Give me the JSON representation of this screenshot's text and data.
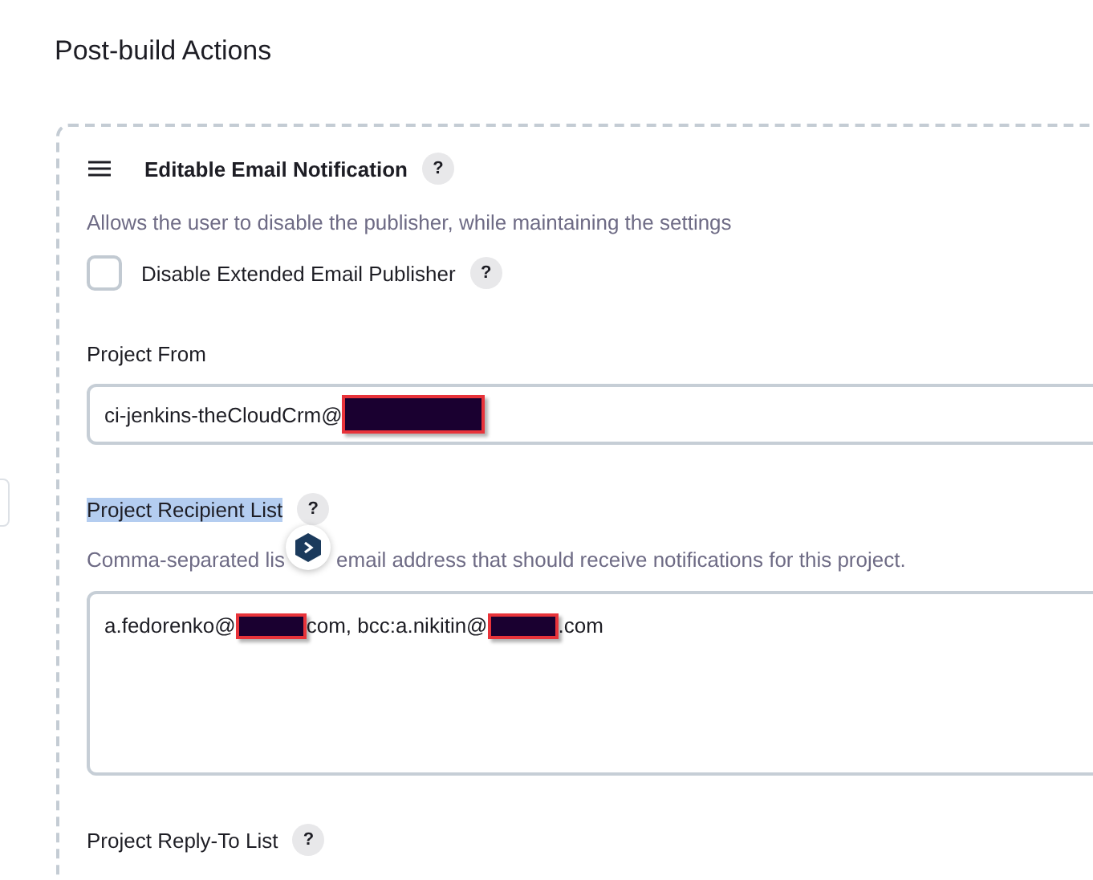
{
  "section_title": "Post-build Actions",
  "publisher": {
    "title": "Editable Email Notification",
    "help": "?",
    "description": "Allows the user to disable the publisher, while maintaining the settings",
    "disable_option": {
      "label": "Disable Extended Email Publisher",
      "help": "?",
      "checked": false
    },
    "fields": [
      {
        "kind": "input",
        "label": "Project From",
        "highlighted": false,
        "value": [
          {
            "kind": "text",
            "text": "ci-jenkins-theCloudCrm@"
          },
          {
            "kind": "redacted"
          }
        ]
      },
      {
        "kind": "textarea",
        "label": "Project Recipient List",
        "highlighted": true,
        "help": "?",
        "description": [
          "Comma-separated lis",
          "email address that should receive notifications for this project."
        ],
        "value": [
          {
            "kind": "text",
            "text": "a.fedorenko@"
          },
          {
            "kind": "redacted"
          },
          {
            "kind": "text",
            "text": "com, bcc:a.nikitin@"
          },
          {
            "kind": "redacted"
          },
          {
            "kind": "text",
            "text": ".com"
          }
        ]
      },
      {
        "kind": "label",
        "label": "Project Reply-To List",
        "highlighted": false,
        "help": "?"
      }
    ]
  }
}
